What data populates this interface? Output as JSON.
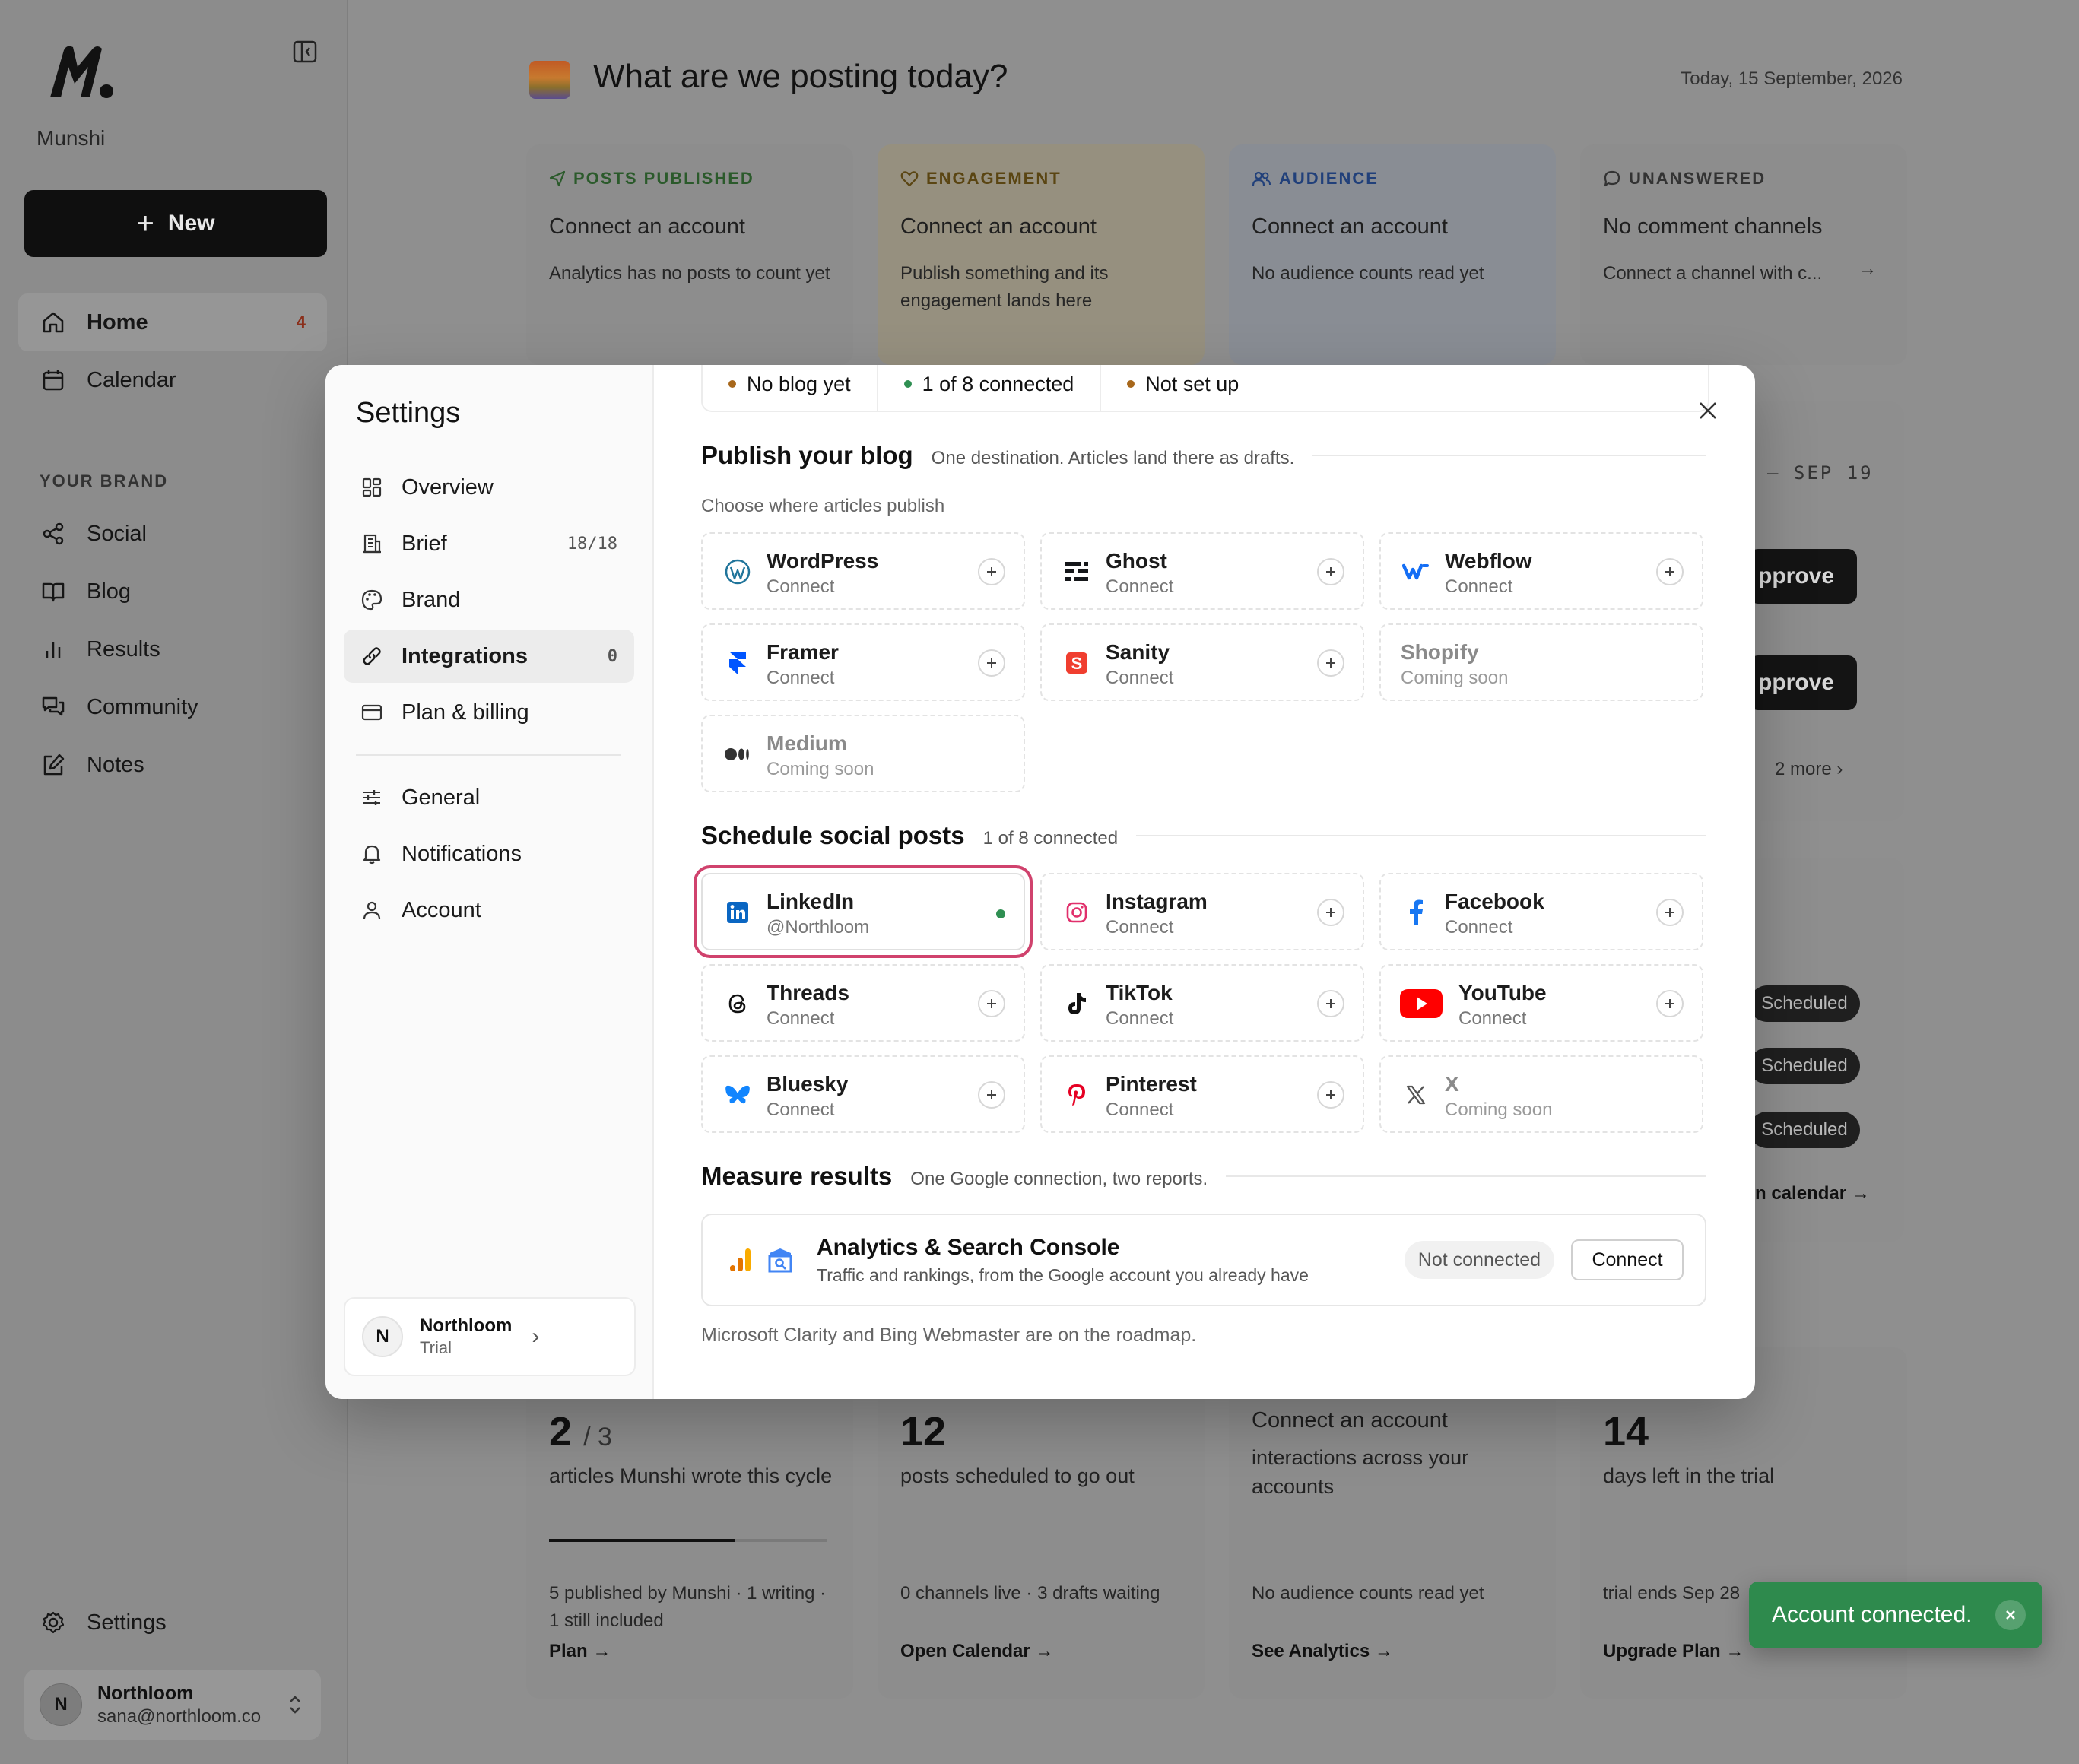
{
  "sidebar": {
    "brand_name": "Munshi",
    "new_label": "New",
    "nav": [
      {
        "label": "Home",
        "badge": "4"
      },
      {
        "label": "Calendar"
      }
    ],
    "section_label": "YOUR BRAND",
    "brand_nav": [
      {
        "label": "Social"
      },
      {
        "label": "Blog"
      },
      {
        "label": "Results"
      },
      {
        "label": "Community"
      },
      {
        "label": "Notes"
      }
    ],
    "settings_label": "Settings",
    "user": {
      "initial": "N",
      "name": "Northloom",
      "email": "sana@northloom.co"
    }
  },
  "main": {
    "title": "What are we posting today?",
    "date": "Today, 15 September, 2026",
    "stats": [
      {
        "label": "POSTS PUBLISHED",
        "title": "Connect an account",
        "sub": "Analytics has no posts to count yet",
        "color": "#2b5a2b"
      },
      {
        "label": "ENGAGEMENT",
        "title": "Connect an account",
        "sub": "Publish something and its engagement lands here",
        "color": "#5a4512"
      },
      {
        "label": "AUDIENCE",
        "title": "Connect an account",
        "sub": "No audience counts read yet",
        "color": "#21407a"
      },
      {
        "label": "UNANSWERED",
        "title": "No comment channels",
        "sub": "Connect a channel with c...",
        "color": "#333333"
      }
    ],
    "right_panel": {
      "date_range": "– SEP 19",
      "approve_1": "pprove",
      "approve_2": "pprove",
      "more": "2 more"
    },
    "scheduled": [
      "Scheduled",
      "Scheduled",
      "Scheduled"
    ],
    "calendar_link": "n calendar →",
    "bottom": [
      {
        "num": "2",
        "suffix": "/ 3",
        "desc": "articles Munshi wrote this cycle",
        "foot": "5 published by Munshi · 1 writing · 1 still included",
        "link": "Plan →",
        "progress": 0.67
      },
      {
        "num": "12",
        "suffix": "",
        "desc": "posts scheduled to go out",
        "foot": "0 channels live · 3 drafts waiting",
        "link": "Open Calendar →"
      },
      {
        "num": "",
        "suffix": "",
        "title": "Connect an account",
        "desc": "interactions across your accounts",
        "foot": "No audience counts read yet",
        "link": "See Analytics →"
      },
      {
        "num": "14",
        "suffix": "",
        "desc": "days left in the trial",
        "foot": "trial ends Sep 28",
        "link": "Upgrade Plan →"
      }
    ]
  },
  "modal": {
    "title": "Settings",
    "menu": [
      {
        "label": "Overview"
      },
      {
        "label": "Brief",
        "count": "18/18"
      },
      {
        "label": "Brand"
      },
      {
        "label": "Integrations",
        "count": "0"
      },
      {
        "label": "Plan & billing"
      },
      {
        "label": "General"
      },
      {
        "label": "Notifications"
      },
      {
        "label": "Account"
      }
    ],
    "user": {
      "initial": "N",
      "name": "Northloom",
      "plan": "Trial"
    },
    "status": [
      {
        "text": "No blog yet",
        "color": "#a7671b"
      },
      {
        "text": "1 of 8 connected",
        "color": "#2f8f52"
      },
      {
        "text": "Not set up",
        "color": "#a7671b"
      }
    ],
    "blog": {
      "title": "Publish your blog",
      "subtitle": "One destination. Articles land there as drafts.",
      "hint": "Choose where articles publish",
      "tiles": [
        {
          "name": "WordPress",
          "sub": "Connect"
        },
        {
          "name": "Ghost",
          "sub": "Connect"
        },
        {
          "name": "Webflow",
          "sub": "Connect"
        },
        {
          "name": "Framer",
          "sub": "Connect"
        },
        {
          "name": "Sanity",
          "sub": "Connect"
        },
        {
          "name": "Shopify",
          "sub": "Coming soon"
        },
        {
          "name": "Medium",
          "sub": "Coming soon"
        }
      ]
    },
    "social": {
      "title": "Schedule social posts",
      "subtitle": "1 of 8 connected",
      "tiles": [
        {
          "name": "LinkedIn",
          "sub": "@Northloom"
        },
        {
          "name": "Instagram",
          "sub": "Connect"
        },
        {
          "name": "Facebook",
          "sub": "Connect"
        },
        {
          "name": "Threads",
          "sub": "Connect"
        },
        {
          "name": "TikTok",
          "sub": "Connect"
        },
        {
          "name": "YouTube",
          "sub": "Connect"
        },
        {
          "name": "Bluesky",
          "sub": "Connect"
        },
        {
          "name": "Pinterest",
          "sub": "Connect"
        },
        {
          "name": "X",
          "sub": "Coming soon"
        }
      ]
    },
    "measure": {
      "title": "Measure results",
      "subtitle": "One Google connection, two reports.",
      "card_title": "Analytics & Search Console",
      "card_sub": "Traffic and rankings, from the Google account you already have",
      "status": "Not connected",
      "connect": "Connect",
      "footnote": "Microsoft Clarity and Bing Webmaster are on the roadmap."
    }
  },
  "toast": {
    "text": "Account connected."
  },
  "colors": {
    "accent_highlight": "#d0426d",
    "success": "#2e8a4d",
    "linkedin": "#0a66c2",
    "youtube": "#ff0000"
  }
}
